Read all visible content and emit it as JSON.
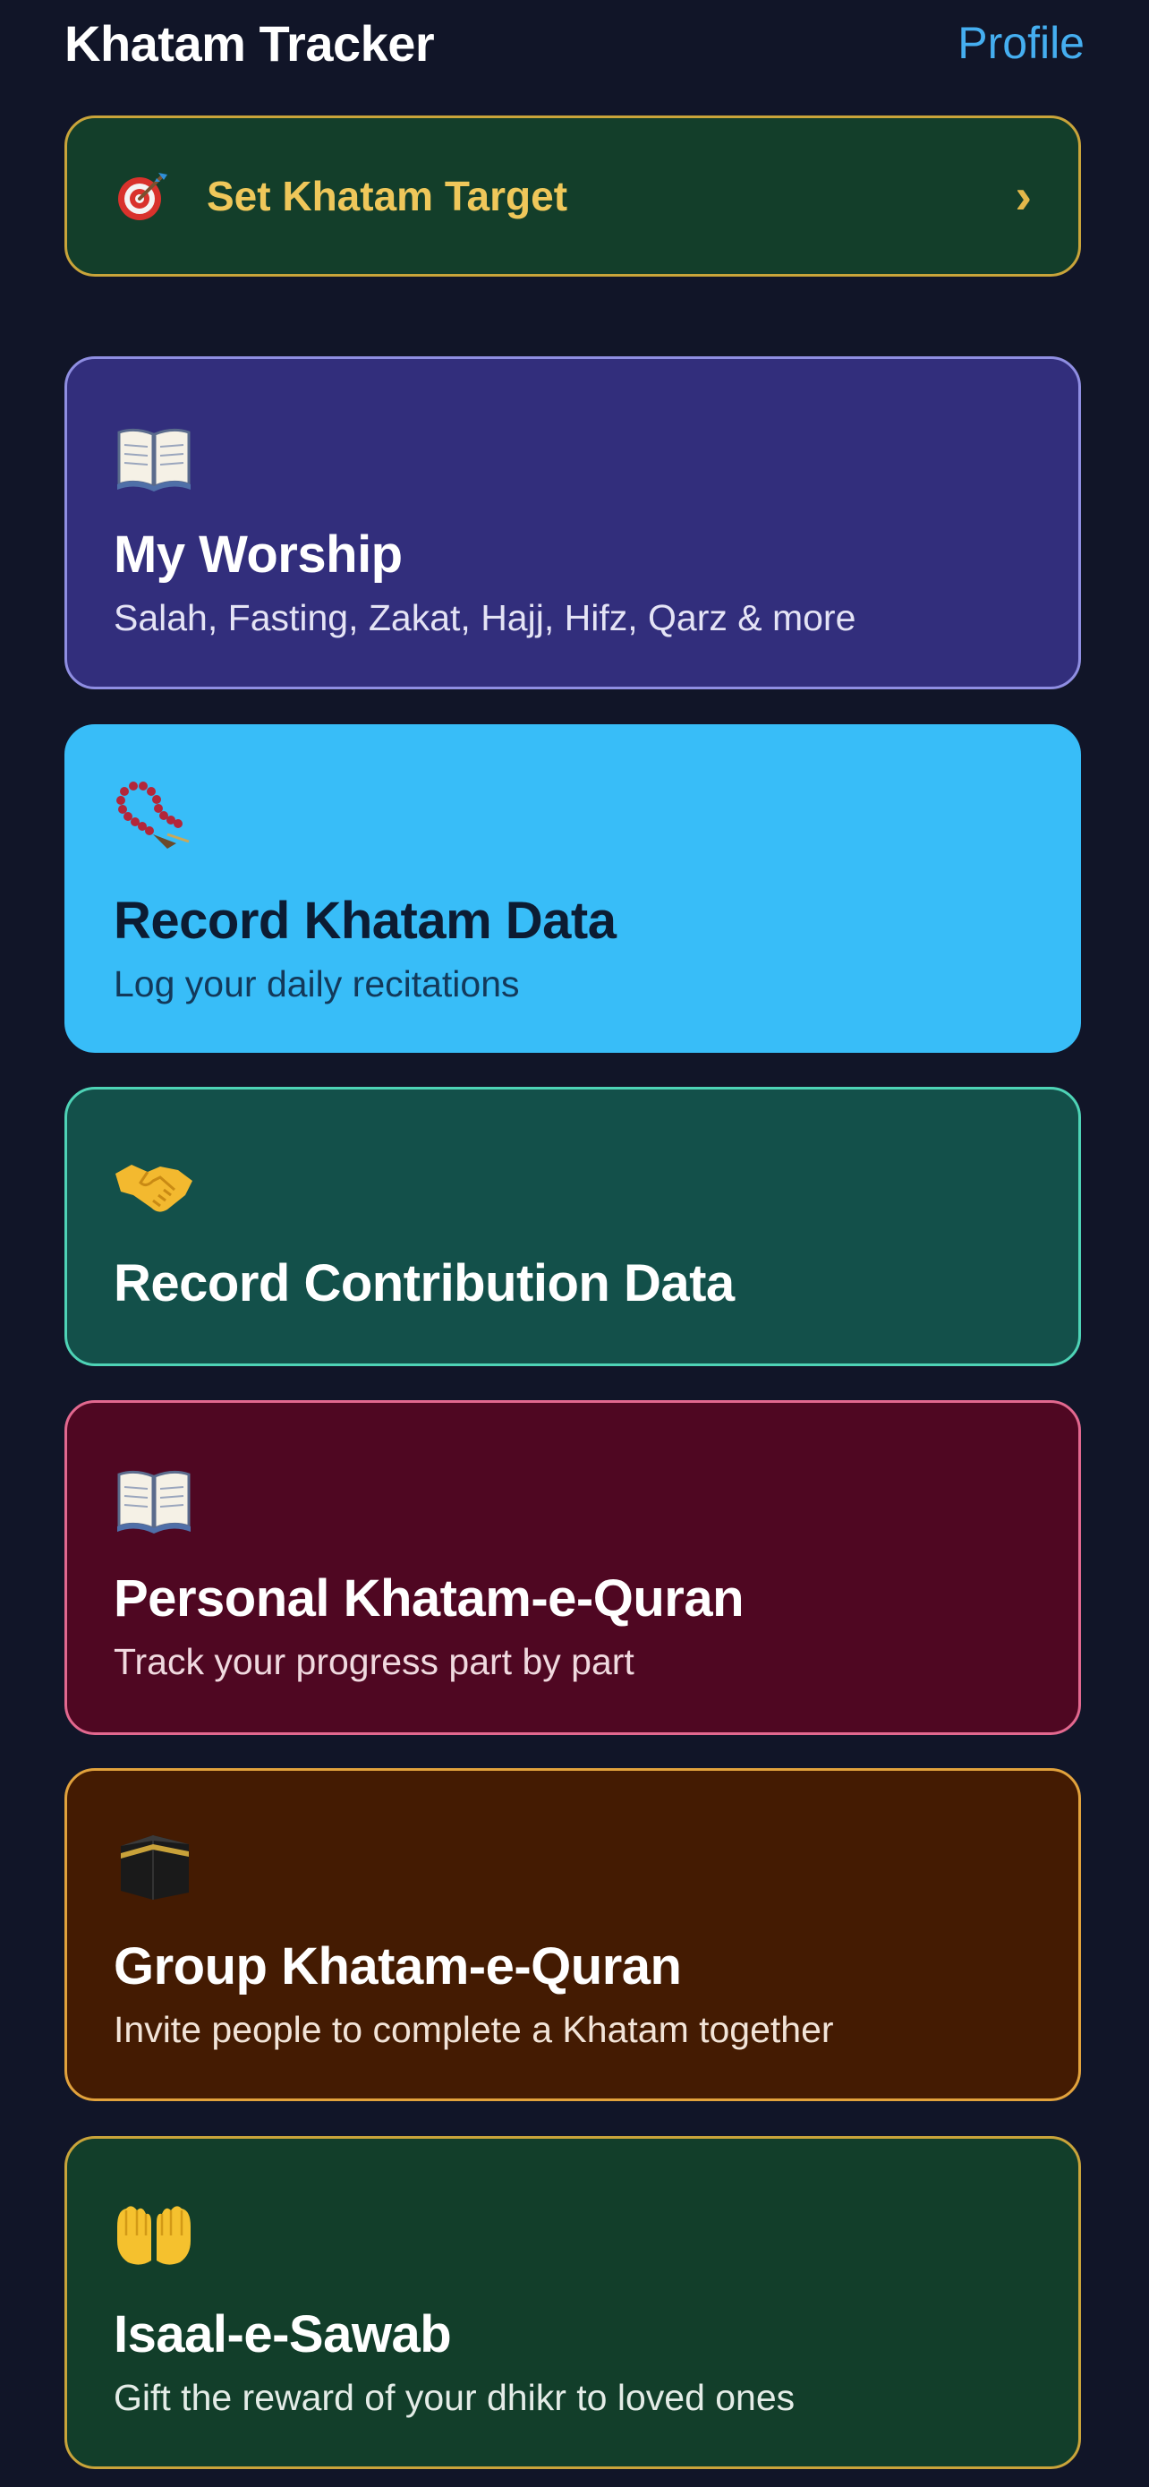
{
  "header": {
    "title": "Khatam Tracker",
    "profile_label": "Profile"
  },
  "target": {
    "label": "Set Khatam Target",
    "icon": "dart-target-icon",
    "chevron": "›"
  },
  "cards": [
    {
      "icon": "open-book-icon",
      "title": "My Worship",
      "subtitle": "Salah, Fasting, Zakat, Hajj, Hifz, Qarz & more"
    },
    {
      "icon": "prayer-beads-icon",
      "title": "Record Khatam Data",
      "subtitle": "Log your daily recitations"
    },
    {
      "icon": "handshake-icon",
      "title": "Record Contribution Data",
      "subtitle": ""
    },
    {
      "icon": "open-book-icon",
      "title": "Personal Khatam-e-Quran",
      "subtitle": "Track your progress part by part"
    },
    {
      "icon": "kaaba-icon",
      "title": "Group Khatam-e-Quran",
      "subtitle": "Invite people to complete a Khatam together"
    },
    {
      "icon": "open-hands-icon",
      "title": "Isaal-e-Sawab",
      "subtitle": "Gift the reward of your dhikr to loved ones"
    }
  ],
  "colors": {
    "background": "#111528",
    "accent_blue": "#45aef0",
    "gold": "#efc75a"
  }
}
